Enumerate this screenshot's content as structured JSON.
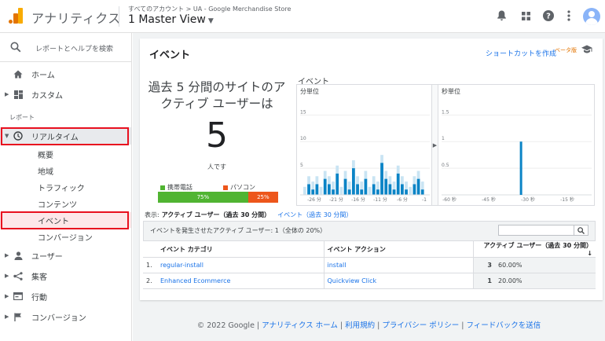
{
  "header": {
    "app_title": "アナリティクス",
    "account_path": "すべてのアカウント > UA - Google Merchandise Store",
    "view_name": "1 Master View",
    "icons": [
      "bell-icon",
      "apps-icon",
      "help-icon",
      "more-vert-icon",
      "avatar"
    ]
  },
  "sidebar": {
    "search_label": "レポートとヘルプを検索",
    "items": [
      {
        "label": "ホーム",
        "icon": "home-icon"
      },
      {
        "label": "カスタム",
        "icon": "dashboard-icon"
      }
    ],
    "section_label": "レポート",
    "realtime": {
      "label": "リアルタイム",
      "icon": "clock-icon",
      "subitems": [
        "概要",
        "地域",
        "トラフィック",
        "コンテンツ",
        "イベント",
        "コンバージョン"
      ]
    },
    "more_items": [
      {
        "label": "ユーザー",
        "icon": "person-icon"
      },
      {
        "label": "集客",
        "icon": "acquisition-icon"
      },
      {
        "label": "行動",
        "icon": "behavior-icon"
      },
      {
        "label": "コンバージョン",
        "icon": "flag-icon"
      }
    ]
  },
  "main": {
    "title": "イベント",
    "shortcut_label": "ショートカットを作成",
    "beta_label": "ベータ版",
    "active_text": "過去 5 分間のサイトのアクティブ ユーザーは",
    "active_number": "5",
    "active_unit": "人です",
    "device_legend": {
      "mobile": "携帯電話",
      "pc": "パソコン"
    },
    "device_split": {
      "mobile_pct": 75,
      "mobile_label": "75%",
      "pc_pct": 25,
      "pc_label": "25%"
    },
    "colors": {
      "mobile": "#50b432",
      "pc": "#ed561b",
      "accent": "#1a73e8",
      "bar": "#0b84c6",
      "bar_light": "#c9e4f3"
    },
    "chart_title": "イベント",
    "tabs": {
      "prefix": "表示:",
      "active": "アクティブ ユーザー（過去 30 分間）",
      "other": "イベント（過去 30 分間）"
    },
    "table": {
      "caption": "イベントを発生させたアクティブ ユーザー: 1（全体の 20%）",
      "headers": {
        "category": "イベント カテゴリ",
        "action": "イベント アクション",
        "users": "アクティブ ユーザー（過去 30 分間）"
      },
      "rows": [
        {
          "idx": "1.",
          "category": "regular-install",
          "action": "install",
          "users": "3",
          "pct": "60.00%"
        },
        {
          "idx": "2.",
          "category": "Enhanced Ecommerce",
          "action": "Quickview Click",
          "users": "1",
          "pct": "20.00%"
        }
      ]
    }
  },
  "chart_data": [
    {
      "type": "bar",
      "title": "分単位",
      "y_ticks": [
        "15",
        "10",
        "5"
      ],
      "x_ticks": [
        "-26 分",
        "-21 分",
        "-16 分",
        "-11 分",
        "-6 分",
        "-1"
      ],
      "ylim": [
        0,
        18
      ],
      "values": [
        0,
        2,
        1,
        2,
        0,
        3,
        2,
        1,
        4,
        0,
        3,
        1,
        5,
        2,
        1,
        3,
        0,
        2,
        1,
        6,
        3,
        2,
        1,
        4,
        2,
        1,
        0,
        2,
        3,
        1
      ]
    },
    {
      "type": "bar",
      "title": "秒単位",
      "y_ticks": [
        "1.5",
        "1",
        "0.5"
      ],
      "x_ticks": [
        "-60 秒",
        "-45 秒",
        "-30 秒",
        "-15 秒"
      ],
      "ylim": [
        0,
        1.8
      ],
      "spike_x": -29,
      "spike_value": 1
    }
  ],
  "footer": {
    "copyright": "© 2022 Google",
    "links": [
      "アナリティクス ホーム",
      "利用規約",
      "プライバシー ポリシー",
      "フィードバックを送信"
    ]
  }
}
